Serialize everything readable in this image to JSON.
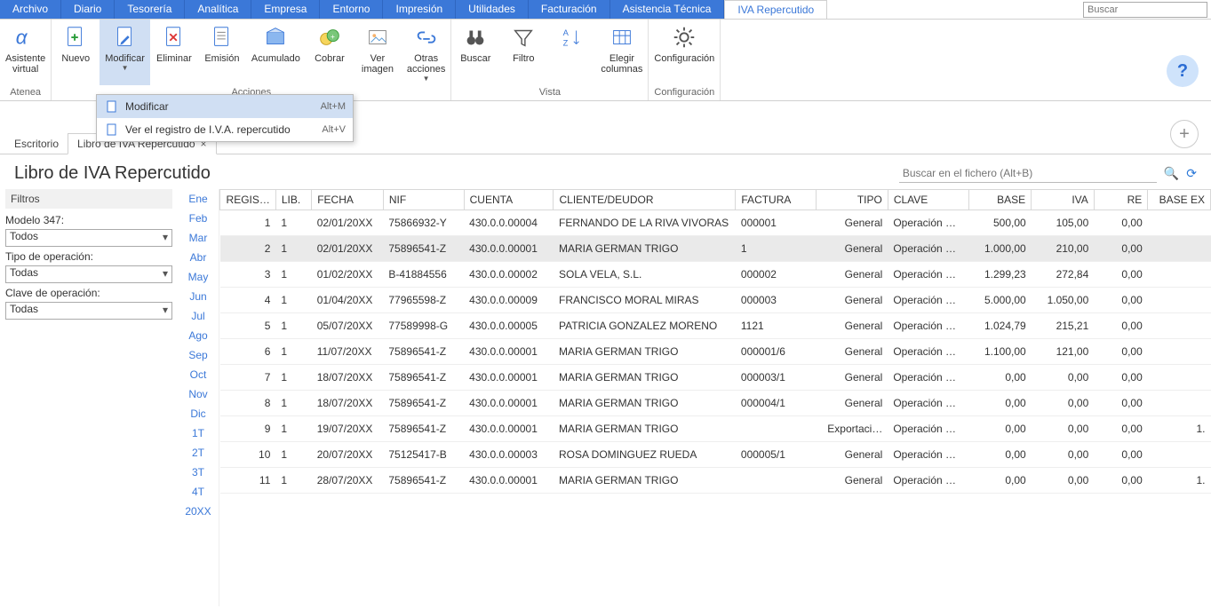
{
  "menu": {
    "items": [
      "Archivo",
      "Diario",
      "Tesorería",
      "Analítica",
      "Empresa",
      "Entorno",
      "Impresión",
      "Utilidades",
      "Facturación",
      "Asistencia Técnica",
      "IVA Repercutido"
    ],
    "active_index": 10,
    "search_placeholder": "Buscar"
  },
  "ribbon": {
    "groups": [
      {
        "caption": "Atenea",
        "buttons": [
          {
            "label": "Asistente\nvirtual",
            "icon": "alpha"
          }
        ]
      },
      {
        "caption": "Acciones",
        "buttons": [
          {
            "label": "Nuevo",
            "icon": "doc-plus"
          },
          {
            "label": "Modificar",
            "icon": "doc-edit",
            "selected": true,
            "dropdown": true
          },
          {
            "label": "Eliminar",
            "icon": "doc-x"
          },
          {
            "label": "Emisión",
            "icon": "doc-lines"
          },
          {
            "label": "Acumulado",
            "icon": "box"
          },
          {
            "label": "Cobrar",
            "icon": "coins"
          },
          {
            "label": "Ver\nimagen",
            "icon": "picture"
          },
          {
            "label": "Otras\nacciones",
            "icon": "links",
            "dropdown": true
          }
        ]
      },
      {
        "caption": "Vista",
        "buttons": [
          {
            "label": "Buscar",
            "icon": "binoc"
          },
          {
            "label": "Filtro",
            "icon": "funnel"
          },
          {
            "label": "",
            "icon": "sort"
          },
          {
            "label": "Elegir\ncolumnas",
            "icon": "columns"
          }
        ]
      },
      {
        "caption": "Configuración",
        "buttons": [
          {
            "label": "Configuración",
            "icon": "gear"
          }
        ]
      }
    ]
  },
  "modify_menu": {
    "items": [
      {
        "label": "Modificar",
        "shortcut": "Alt+M",
        "selected": true
      },
      {
        "label": "Ver el registro de I.V.A. repercutido",
        "shortcut": "Alt+V"
      }
    ]
  },
  "tabs": {
    "items": [
      {
        "label": "Escritorio",
        "closable": false,
        "active": false
      },
      {
        "label": "Libro de IVA Repercutido",
        "closable": true,
        "active": true
      }
    ]
  },
  "page": {
    "title": "Libro de IVA Repercutido",
    "file_search_placeholder": "Buscar en el fichero (Alt+B)"
  },
  "filters": {
    "title": "Filtros",
    "modelo_label": "Modelo 347:",
    "modelo_value": "Todos",
    "tipo_label": "Tipo de operación:",
    "tipo_value": "Todas",
    "clave_label": "Clave de operación:",
    "clave_value": "Todas"
  },
  "months": [
    "Ene",
    "Feb",
    "Mar",
    "Abr",
    "May",
    "Jun",
    "Jul",
    "Ago",
    "Sep",
    "Oct",
    "Nov",
    "Dic",
    "1T",
    "2T",
    "3T",
    "4T",
    "20XX"
  ],
  "table": {
    "headers": [
      "REGIS…",
      "LIB.",
      "FECHA",
      "NIF",
      "CUENTA",
      "CLIENTE/DEUDOR",
      "FACTURA",
      "TIPO",
      "CLAVE",
      "BASE",
      "IVA",
      "RE",
      "BASE EX"
    ],
    "numeric_cols": [
      0,
      9,
      10,
      11,
      12
    ],
    "right_cols": [
      7
    ],
    "rows": [
      [
        "1",
        "1",
        "02/01/20XX",
        "75866932-Y",
        "430.0.0.00004",
        "FERNANDO DE LA RIVA VIVORAS",
        "000001",
        "General",
        "Operación …",
        "500,00",
        "105,00",
        "0,00",
        ""
      ],
      [
        "2",
        "1",
        "02/01/20XX",
        "75896541-Z",
        "430.0.0.00001",
        "MARIA GERMAN TRIGO",
        "1",
        "General",
        "Operación …",
        "1.000,00",
        "210,00",
        "0,00",
        ""
      ],
      [
        "3",
        "1",
        "01/02/20XX",
        "B-41884556",
        "430.0.0.00002",
        "SOLA VELA, S.L.",
        "000002",
        "General",
        "Operación …",
        "1.299,23",
        "272,84",
        "0,00",
        ""
      ],
      [
        "4",
        "1",
        "01/04/20XX",
        "77965598-Z",
        "430.0.0.00009",
        "FRANCISCO MORAL MIRAS",
        "000003",
        "General",
        "Operación …",
        "5.000,00",
        "1.050,00",
        "0,00",
        ""
      ],
      [
        "5",
        "1",
        "05/07/20XX",
        "77589998-G",
        "430.0.0.00005",
        "PATRICIA GONZALEZ MORENO",
        "1121",
        "General",
        "Operación …",
        "1.024,79",
        "215,21",
        "0,00",
        ""
      ],
      [
        "6",
        "1",
        "11/07/20XX",
        "75896541-Z",
        "430.0.0.00001",
        "MARIA GERMAN TRIGO",
        "000001/6",
        "General",
        "Operación …",
        "1.100,00",
        "121,00",
        "0,00",
        ""
      ],
      [
        "7",
        "1",
        "18/07/20XX",
        "75896541-Z",
        "430.0.0.00001",
        "MARIA GERMAN TRIGO",
        "000003/1",
        "General",
        "Operación …",
        "0,00",
        "0,00",
        "0,00",
        ""
      ],
      [
        "8",
        "1",
        "18/07/20XX",
        "75896541-Z",
        "430.0.0.00001",
        "MARIA GERMAN TRIGO",
        "000004/1",
        "General",
        "Operación …",
        "0,00",
        "0,00",
        "0,00",
        ""
      ],
      [
        "9",
        "1",
        "19/07/20XX",
        "75896541-Z",
        "430.0.0.00001",
        "MARIA GERMAN TRIGO",
        "",
        "Exportaci…",
        "Operación …",
        "0,00",
        "0,00",
        "0,00",
        "1."
      ],
      [
        "10",
        "1",
        "20/07/20XX",
        "75125417-B",
        "430.0.0.00003",
        "ROSA DOMINGUEZ RUEDA",
        "000005/1",
        "General",
        "Operación …",
        "0,00",
        "0,00",
        "0,00",
        ""
      ],
      [
        "11",
        "1",
        "28/07/20XX",
        "75896541-Z",
        "430.0.0.00001",
        "MARIA GERMAN TRIGO",
        "",
        "General",
        "Operación …",
        "0,00",
        "0,00",
        "0,00",
        "1."
      ]
    ],
    "selected_row": 1
  }
}
